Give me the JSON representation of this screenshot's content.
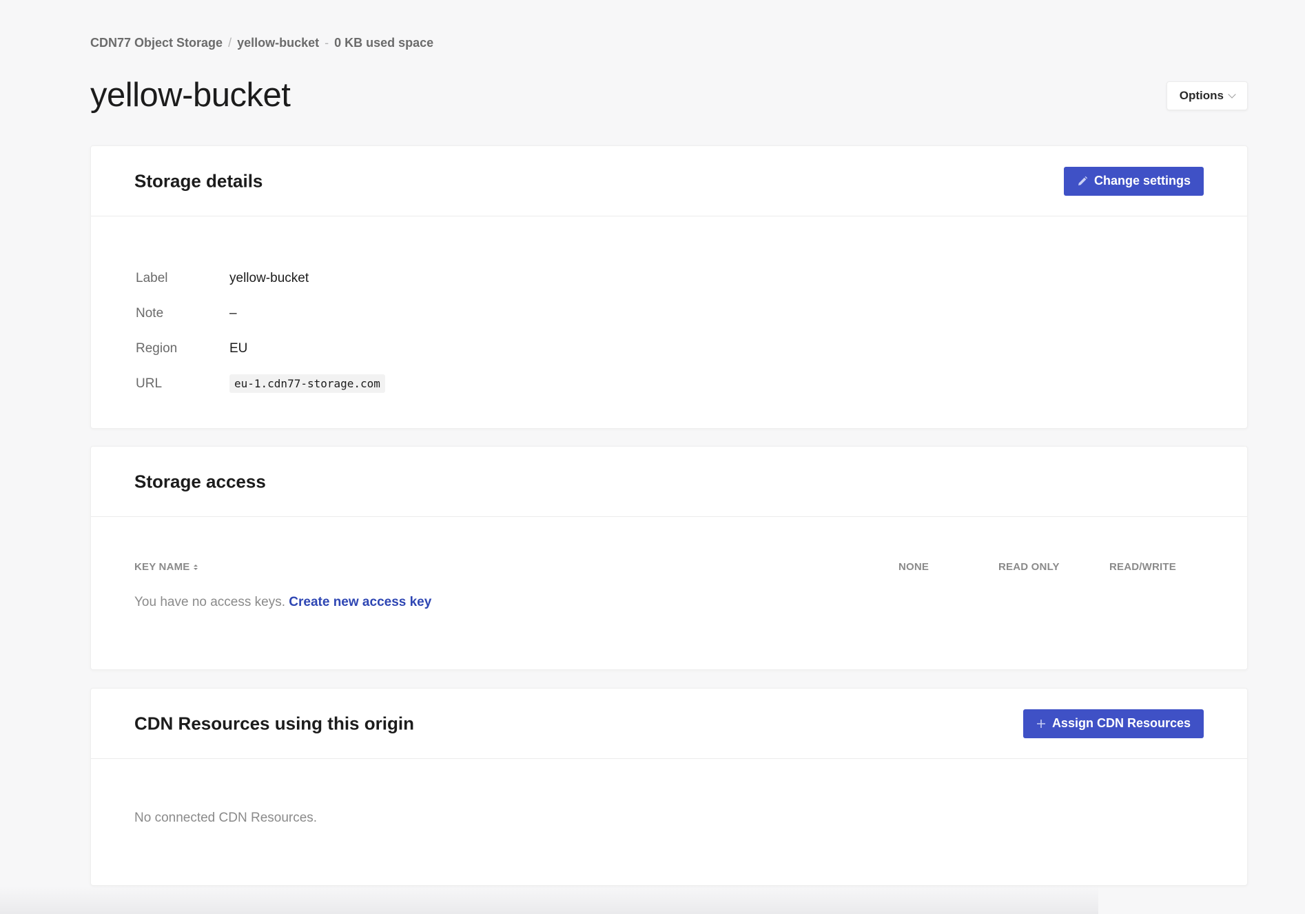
{
  "breadcrumb": {
    "root": "CDN77 Object Storage",
    "separator": "/",
    "bucket": "yellow-bucket",
    "dash": "-",
    "usage": "0 KB used space"
  },
  "page": {
    "title": "yellow-bucket",
    "options_label": "Options"
  },
  "storage_details": {
    "title": "Storage details",
    "change_settings_label": "Change settings",
    "rows": [
      {
        "label": "Label",
        "value": "yellow-bucket"
      },
      {
        "label": "Note",
        "value": "–"
      },
      {
        "label": "Region",
        "value": "EU"
      },
      {
        "label": "URL",
        "value": "eu-1.cdn77-storage.com"
      }
    ]
  },
  "storage_access": {
    "title": "Storage access",
    "columns": {
      "key_name": "KEY NAME",
      "none": "NONE",
      "read_only": "READ ONLY",
      "read_write": "READ/WRITE"
    },
    "empty_text": "You have no access keys.",
    "create_link": "Create new access key"
  },
  "cdn_resources": {
    "title": "CDN Resources using this origin",
    "assign_label": "Assign CDN Resources",
    "empty_text": "No connected CDN Resources."
  },
  "colors": {
    "primary": "#3f51c6",
    "link": "#2e46b3",
    "background": "#f7f7f8"
  },
  "icons": {
    "change_settings": "pencil-icon",
    "assign": "plus-icon",
    "options": "chevron-down-icon",
    "sort": "sort-icon"
  }
}
